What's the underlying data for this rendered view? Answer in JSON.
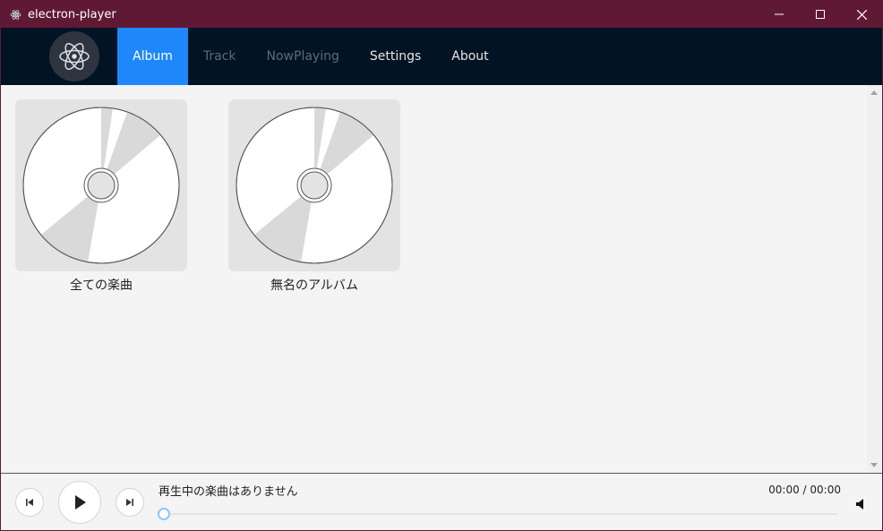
{
  "window": {
    "title": "electron-player",
    "app_icon": "electron-atom-icon",
    "controls": [
      "minimize-icon",
      "maximize-icon",
      "close-icon"
    ]
  },
  "navbar": {
    "logo": "electron-atom-icon",
    "items": [
      {
        "label": "Album",
        "state": "active"
      },
      {
        "label": "Track",
        "state": "disabled"
      },
      {
        "label": "NowPlaying",
        "state": "disabled"
      },
      {
        "label": "Settings",
        "state": "normal"
      },
      {
        "label": "About",
        "state": "normal"
      }
    ]
  },
  "albums": [
    {
      "name": "全ての楽曲",
      "art": "cd-disc-icon"
    },
    {
      "name": "無名のアルバム",
      "art": "cd-disc-icon"
    }
  ],
  "player": {
    "now_playing": "再生中の楽曲はありません",
    "time": "00:00 / 00:00",
    "progress": 0,
    "buttons": [
      "previous-track-icon",
      "play-icon",
      "next-track-icon",
      "volume-icon"
    ]
  },
  "colors": {
    "titlebar": "#5f1935",
    "navbar": "#021324",
    "accent": "#1e88fa",
    "content_bg": "#f4f4f4"
  }
}
